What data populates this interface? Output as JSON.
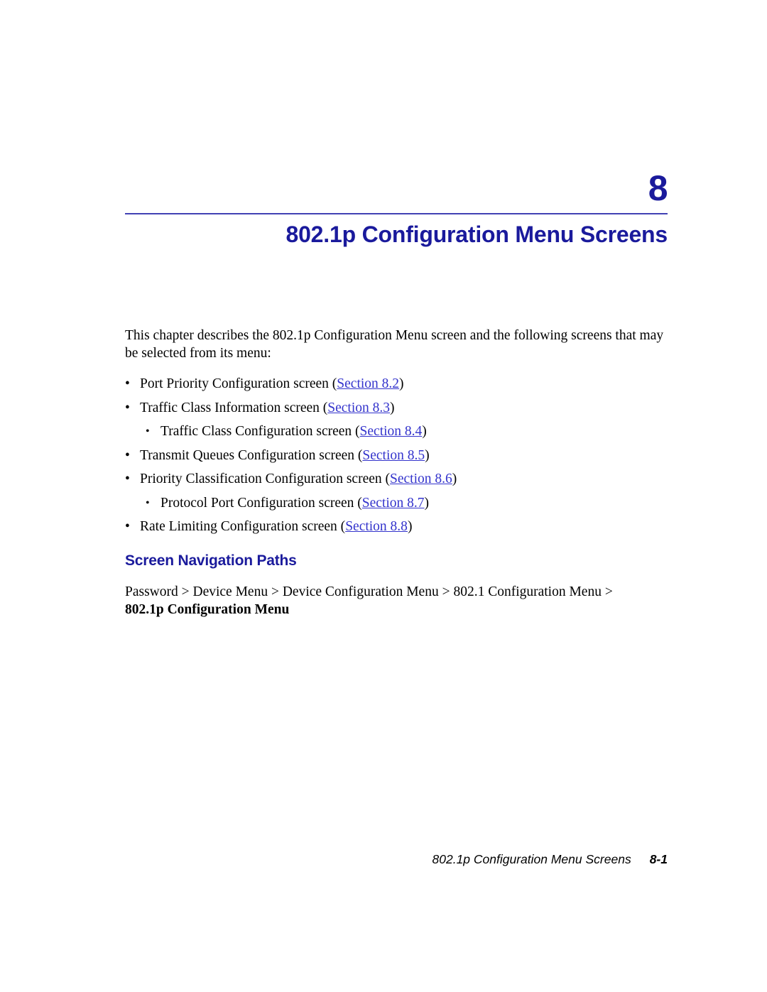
{
  "chapter": {
    "number": "8",
    "title": "802.1p Configuration Menu Screens",
    "rule_color": "#4141b4",
    "accent_color": "#1a1a9c"
  },
  "intro": {
    "text": "This chapter describes the 802.1p Configuration Menu screen and the following screens that may be selected from its menu:"
  },
  "bullets": [
    {
      "bullet": "•",
      "text": "Port Priority Configuration screen (",
      "xref": "Section 8.2",
      "text_after": ")",
      "nested": false
    },
    {
      "bullet": "•",
      "text": "Traffic Class Information screen (",
      "xref": "Section 8.3",
      "text_after": ")",
      "nested": false
    },
    {
      "bullet": "•",
      "text": "Traffic Class Configuration screen (",
      "xref": "Section 8.4",
      "text_after": ")",
      "nested": true
    },
    {
      "bullet": "•",
      "text": "Transmit Queues Configuration screen (",
      "xref": "Section 8.5",
      "text_after": ")",
      "nested": false
    },
    {
      "bullet": "•",
      "text": "Priority Classification Configuration screen (",
      "xref": "Section 8.6",
      "text_after": ")",
      "nested": false
    },
    {
      "bullet": "•",
      "text": "Protocol Port Configuration screen (",
      "xref": "Section 8.7",
      "text_after": ")",
      "nested": true
    },
    {
      "bullet": "•",
      "text": "Rate Limiting Configuration screen (",
      "xref": "Section 8.8",
      "text_after": ")",
      "nested": false
    }
  ],
  "navigation": {
    "heading": "Screen Navigation Paths",
    "path_line": "Password > Device Menu > Device Configuration Menu > 802.1 Configuration Menu >",
    "path_bold": "802.1p Configuration Menu"
  },
  "footer": {
    "title": "802.1p Configuration Menu Screens",
    "page": "8-1"
  },
  "xref_color": "#3333cc"
}
